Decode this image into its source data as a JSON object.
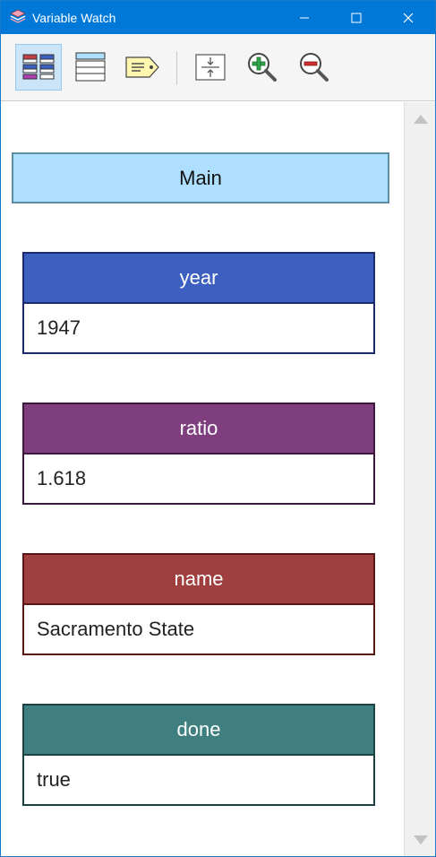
{
  "window": {
    "title": "Variable Watch",
    "accent": "#0078d7"
  },
  "toolbar": {
    "buttons": [
      {
        "icon": "frame-view-icon",
        "active": true
      },
      {
        "icon": "list-view-icon",
        "active": false
      },
      {
        "icon": "tag-icon",
        "active": false
      },
      {
        "icon": "fit-height-icon",
        "active": false
      },
      {
        "icon": "zoom-in-icon",
        "active": false
      },
      {
        "icon": "zoom-out-icon",
        "active": false
      }
    ]
  },
  "frame": {
    "label": "Main",
    "color": "#afdfff"
  },
  "variables": [
    {
      "name": "year",
      "value": "1947",
      "color": "#3d5fc0",
      "border": "#1a2a6a"
    },
    {
      "name": "ratio",
      "value": "1.618",
      "color": "#7f3f7f",
      "border": "#3d1a3d"
    },
    {
      "name": "name",
      "value": "Sacramento State",
      "color": "#a03f3f",
      "border": "#5a1515"
    },
    {
      "name": "done",
      "value": "true",
      "color": "#3f7f7f",
      "border": "#1a4242"
    }
  ]
}
